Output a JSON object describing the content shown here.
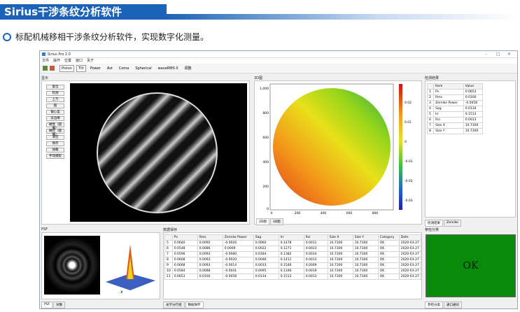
{
  "banner": {
    "title": "Sirius干涉条纹分析软件"
  },
  "subtitle": "标配机械移相干涉条纹分析软件，实现数字化测量。",
  "window": {
    "title": "Sirius Pro 2.0",
    "menu": [
      "文件",
      "操作",
      "位置",
      "窗口",
      "关于"
    ],
    "toolbar": [
      "Piston",
      "Tilt",
      "Power",
      "Ast",
      "Coma",
      "Spherical",
      "waveRMS 0",
      "调整"
    ],
    "controls": [
      "window-minimize",
      "window-maximize",
      "window-close"
    ],
    "display_label": "显示",
    "tool_buttons": [
      "复位",
      "检测",
      "上万",
      "圆",
      "偏心差",
      "去边缘",
      "磁性（圆偏）",
      "磁控（圆偏）",
      "清空",
      "保存",
      "加载",
      "手动捕捉"
    ],
    "map_label": "3D图",
    "map_y_ticks": [
      "1,000",
      "800",
      "600",
      "400",
      "200",
      "0"
    ],
    "map_x_ticks": [
      "0",
      "200",
      "400",
      "600",
      "800"
    ],
    "colorbar_ticks": [
      "0.02",
      "0.01",
      "0",
      "-0.01",
      "-0.02",
      "-0.03"
    ],
    "map_tabs": [
      "2D图",
      "3D图"
    ],
    "results_label": "检测结果",
    "results_headers": [
      "Item",
      "Value"
    ],
    "results": [
      {
        "n": "1",
        "item": "Pv",
        "value": "0.0653"
      },
      {
        "n": "2",
        "item": "Rms",
        "value": "0.0100"
      },
      {
        "n": "3",
        "item": "Zernike Power",
        "value": "-0.0058"
      },
      {
        "n": "4",
        "item": "Sag",
        "value": "0.0134"
      },
      {
        "n": "5",
        "item": "Irr",
        "value": "0.1513"
      },
      {
        "n": "6",
        "item": "Rsi",
        "value": "0.0013"
      },
      {
        "n": "7",
        "item": "Size X",
        "value": "10.7300"
      },
      {
        "n": "8",
        "item": "Size Y",
        "value": "10.7300"
      }
    ],
    "results_tabs": [
      "检测结果",
      "Zernike"
    ],
    "psf_label": "PSF",
    "psf_tabs": [
      "PSF",
      "对数"
    ],
    "data_label": "数据保存",
    "data_headers": [
      "",
      "Pv",
      "Rms",
      "Zernike Power",
      "Sag",
      "Irr",
      "Rsi",
      "Size X",
      "Size Y",
      "Category",
      "Date"
    ],
    "data_rows": [
      [
        "5",
        "0.0640",
        "0.0092",
        "-0.0026",
        "0.0060",
        "0.1478",
        "0.0011",
        "10.7300",
        "10.7300",
        "OK",
        "2020-03-27"
      ],
      [
        "6",
        "0.0548",
        "0.0086",
        "0.0009",
        "0.0022",
        "0.1271",
        "0.0023",
        "10.7300",
        "10.7300",
        "OK",
        "2020-03-27"
      ],
      [
        "7",
        "0.0596",
        "0.0093",
        "-0.0080",
        "0.0184",
        "0.1382",
        "0.0034",
        "10.7300",
        "10.7300",
        "OK",
        "2020-03-27"
      ],
      [
        "8",
        "0.0608",
        "0.0093",
        "-0.0020",
        "0.0046",
        "0.1411",
        "0.0013",
        "10.7300",
        "10.7300",
        "OK",
        "2020-03-27"
      ],
      [
        "9",
        "0.0668",
        "0.0093",
        "-0.0014",
        "0.0033",
        "0.1546",
        "0.0009",
        "10.7300",
        "10.7300",
        "OK",
        "2020-03-27"
      ],
      [
        "10",
        "0.0584",
        "0.0088",
        "-0.0041",
        "0.0095",
        "0.1346",
        "0.0019",
        "10.7300",
        "10.7300",
        "OK",
        "2020-03-27"
      ],
      [
        "11",
        "0.0653",
        "0.0100",
        "-0.0058",
        "0.0134",
        "0.1513",
        "0.0013",
        "10.7300",
        "10.7300",
        "OK",
        "2020-03-27"
      ]
    ],
    "data_tabs": [
      "光学分行组",
      "数据保存"
    ],
    "status_label": "参检分类",
    "status_value": "OK",
    "status_tabs": [
      "参检分类",
      "通口通讯"
    ],
    "colors": {
      "ok_green": "#0a8a0a",
      "accent": "#1a63b8"
    }
  }
}
